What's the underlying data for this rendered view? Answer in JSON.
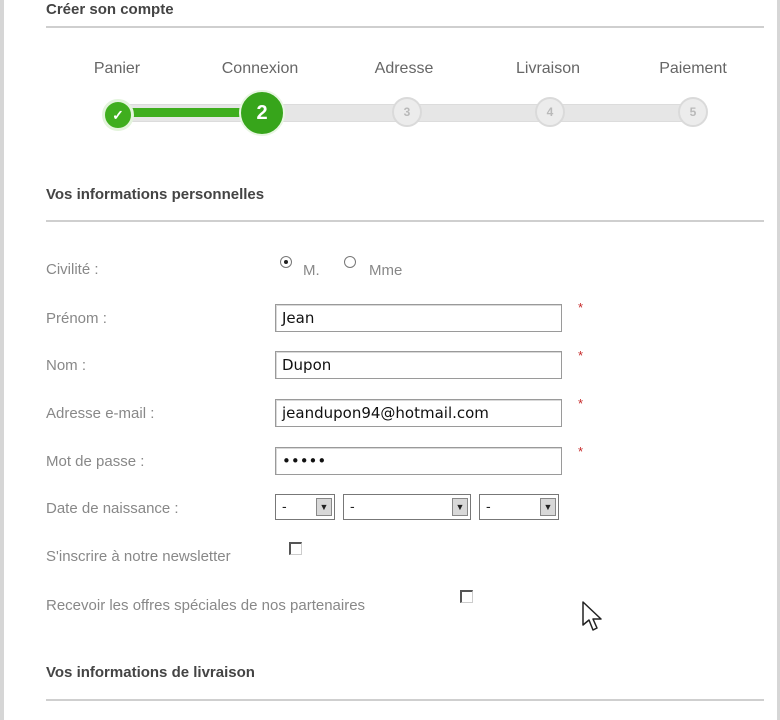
{
  "header": {
    "title": "Créer son compte"
  },
  "steps": [
    {
      "label": "Panier",
      "number": "✓",
      "state": "done"
    },
    {
      "label": "Connexion",
      "number": "2",
      "state": "active"
    },
    {
      "label": "Adresse",
      "number": "3",
      "state": "todo"
    },
    {
      "label": "Livraison",
      "number": "4",
      "state": "todo"
    },
    {
      "label": "Paiement",
      "number": "5",
      "state": "todo"
    }
  ],
  "personal": {
    "title": "Vos informations personnelles",
    "civility": {
      "label": "Civilité :",
      "options": [
        "M.",
        "Mme"
      ],
      "selected": "M."
    },
    "firstname": {
      "label": "Prénom :",
      "value": "Jean"
    },
    "lastname": {
      "label": "Nom :",
      "value": "Dupon"
    },
    "email": {
      "label": "Adresse e-mail :",
      "value": "jeandupon94@hotmail.com"
    },
    "password": {
      "label": "Mot de passe :",
      "value": "•••••"
    },
    "birthdate": {
      "label": "Date de naissance :",
      "day": "-",
      "month": "-",
      "year": "-"
    },
    "newsletter": {
      "label": "S'inscrire à notre newsletter",
      "checked": false
    },
    "partners": {
      "label": "Recevoir les offres spéciales de nos partenaires",
      "checked": false
    }
  },
  "required_mark": "*",
  "delivery": {
    "title": "Vos informations de livraison"
  },
  "colors": {
    "accent": "#3fae1e",
    "required": "#c62828"
  },
  "icons": {
    "done_step": "check-icon",
    "cursor": "arrow-cursor-icon"
  }
}
